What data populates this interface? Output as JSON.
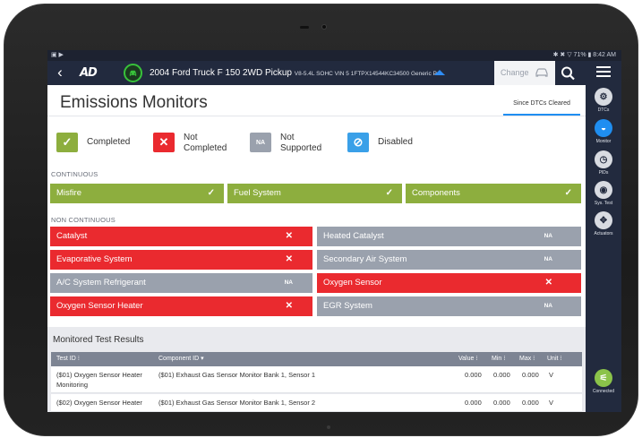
{
  "status_bar": {
    "left_icons": "▣ ▶",
    "right": "✱ ✖ ▽ 71% ▮ 8:42 AM"
  },
  "app_bar": {
    "logo": "AD",
    "vehicle_name": "2004 Ford Truck F 150 2WD Pickup",
    "vehicle_detail": "V8-5.4L SOHC VIN 5 1FTPX14544KC34500 Generic Po...",
    "change_label": "Change"
  },
  "page": {
    "title": "Emissions Monitors",
    "since_tab": "Since DTCs Cleared"
  },
  "legend": [
    {
      "symbol": "✓",
      "label": "Completed",
      "color": "#8dae3e"
    },
    {
      "symbol": "✕",
      "label": "Not\nCompleted",
      "color": "#ea2a2f"
    },
    {
      "symbol": "NA",
      "label": "Not\nSupported",
      "color": "#9aa1ad"
    },
    {
      "symbol": "⊘",
      "label": "Disabled",
      "color": "#3aa0e8"
    }
  ],
  "continuous": {
    "label": "CONTINUOUS",
    "items": [
      {
        "name": "Misfire",
        "status": "✓"
      },
      {
        "name": "Fuel System",
        "status": "✓"
      },
      {
        "name": "Components",
        "status": "✓"
      }
    ]
  },
  "non_continuous": {
    "label": "NON CONTINUOUS",
    "items": [
      {
        "name": "Catalyst",
        "status": "✕"
      },
      {
        "name": "Heated Catalyst",
        "status": "NA"
      },
      {
        "name": "Evaporative System",
        "status": "✕"
      },
      {
        "name": "Secondary Air System",
        "status": "NA"
      },
      {
        "name": "A/C System Refrigerant",
        "status": "NA"
      },
      {
        "name": "Oxygen Sensor",
        "status": "✕"
      },
      {
        "name": "Oxygen Sensor Heater",
        "status": "✕"
      },
      {
        "name": "EGR System",
        "status": "NA"
      }
    ]
  },
  "results": {
    "title": "Monitored Test Results",
    "columns": [
      "Test ID ⁝",
      "Component ID ▾",
      "Value ⁝",
      "Min ⁝",
      "Max ⁝",
      "Unit ⁝"
    ],
    "rows": [
      {
        "test_line1": "($01) Oxygen Sensor Heater",
        "test_line2": "Monitoring",
        "component": "($01) Exhaust Gas Sensor Monitor Bank 1, Sensor 1",
        "value": "0.000",
        "min": "0.000",
        "max": "0.000",
        "unit": "V"
      },
      {
        "test_line1": "($02) Oxygen Sensor Heater",
        "test_line2": "",
        "component": "($01) Exhaust Gas Sensor Monitor Bank 1, Sensor 2",
        "value": "0.000",
        "min": "0.000",
        "max": "0.000",
        "unit": "V"
      }
    ]
  },
  "sidebar": {
    "items": [
      {
        "label": "DTCs",
        "icon": "engine-icon",
        "glyph": "⚙"
      },
      {
        "label": "Monitor",
        "icon": "monitor-icon",
        "glyph": "◒"
      },
      {
        "label": "PIDs",
        "icon": "gauge-icon",
        "glyph": "◷"
      },
      {
        "label": "Sys. Test",
        "icon": "system-test-icon",
        "glyph": "◉"
      },
      {
        "label": "Actuators",
        "icon": "actuators-icon",
        "glyph": "✥"
      }
    ],
    "connected_label": "Connected"
  }
}
